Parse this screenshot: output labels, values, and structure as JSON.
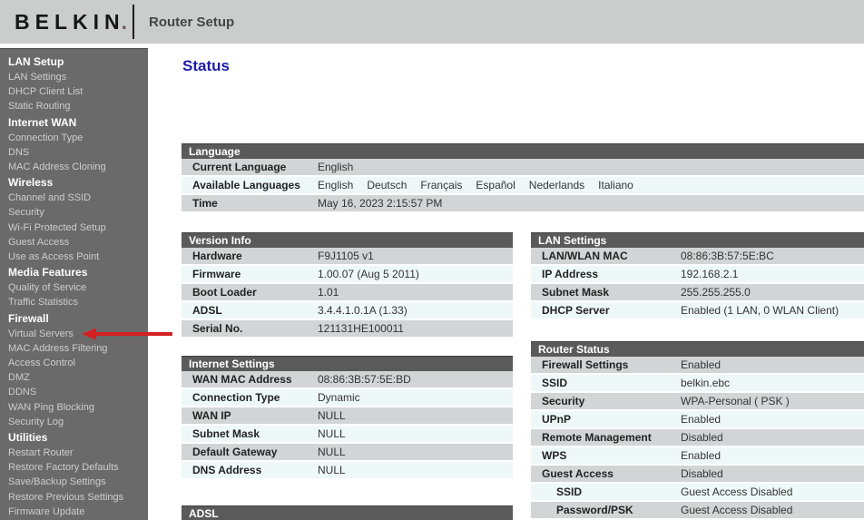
{
  "colors": {
    "accent_red": "#d42020",
    "title_blue": "#1c1cab",
    "header_bg": "#cbcdcd",
    "sidebar_bg": "#6a6a6a",
    "table_header_bg": "#5a5a5a",
    "row_gray": "#d2d5d5",
    "row_light": "#eff8f8"
  },
  "header": {
    "logo": "BELKIN",
    "logo_dot": ".",
    "title": "Router Setup"
  },
  "sidebar": {
    "items": [
      {
        "label": "LAN Setup",
        "type": "section"
      },
      {
        "label": "LAN Settings",
        "type": "link"
      },
      {
        "label": "DHCP Client List",
        "type": "link"
      },
      {
        "label": "Static Routing",
        "type": "link"
      },
      {
        "label": "Internet WAN",
        "type": "section"
      },
      {
        "label": "Connection Type",
        "type": "link"
      },
      {
        "label": "DNS",
        "type": "link"
      },
      {
        "label": "MAC Address Cloning",
        "type": "link"
      },
      {
        "label": "Wireless",
        "type": "section"
      },
      {
        "label": "Channel and SSID",
        "type": "link"
      },
      {
        "label": "Security",
        "type": "link"
      },
      {
        "label": "Wi-Fi Protected Setup",
        "type": "link"
      },
      {
        "label": "Guest Access",
        "type": "link"
      },
      {
        "label": "Use as Access Point",
        "type": "link"
      },
      {
        "label": "Media Features",
        "type": "section"
      },
      {
        "label": "Quality of Service",
        "type": "link"
      },
      {
        "label": "Traffic Statistics",
        "type": "link"
      },
      {
        "label": "Firewall",
        "type": "section"
      },
      {
        "label": "Virtual Servers",
        "type": "link",
        "highlighted": true
      },
      {
        "label": "MAC Address Filtering",
        "type": "link"
      },
      {
        "label": "Access Control",
        "type": "link"
      },
      {
        "label": "DMZ",
        "type": "link"
      },
      {
        "label": "DDNS",
        "type": "link"
      },
      {
        "label": "WAN Ping Blocking",
        "type": "link"
      },
      {
        "label": "Security Log",
        "type": "link"
      },
      {
        "label": "Utilities",
        "type": "section"
      },
      {
        "label": "Restart Router",
        "type": "link"
      },
      {
        "label": "Restore Factory Defaults",
        "type": "link"
      },
      {
        "label": "Save/Backup Settings",
        "type": "link"
      },
      {
        "label": "Restore Previous Settings",
        "type": "link"
      },
      {
        "label": "Firmware Update",
        "type": "link"
      }
    ]
  },
  "annotation": {
    "arrow_target": "Virtual Servers"
  },
  "main": {
    "title": "Status",
    "tables": {
      "language": {
        "title": "Language",
        "rows": [
          {
            "label": "Current Language",
            "value": "English"
          },
          {
            "label": "Available Languages",
            "languages": [
              "English",
              "Deutsch",
              "Français",
              "Español",
              "Nederlands",
              "Italiano"
            ]
          },
          {
            "label": "Time",
            "value": "May 16, 2023  2:15:57 PM"
          }
        ]
      },
      "version_info": {
        "title": "Version Info",
        "rows": [
          {
            "label": "Hardware",
            "value": "F9J1105 v1"
          },
          {
            "label": "Firmware",
            "value": "1.00.07 (Aug 5 2011)"
          },
          {
            "label": "Boot Loader",
            "value": "1.01"
          },
          {
            "label": "ADSL",
            "value": "3.4.4.1.0.1A (1.33)"
          },
          {
            "label": "Serial No.",
            "value": "121131HE100011"
          }
        ]
      },
      "internet_settings": {
        "title": "Internet Settings",
        "rows": [
          {
            "label": "WAN MAC Address",
            "value": "08:86:3B:57:5E:BD"
          },
          {
            "label": "Connection Type",
            "value": "Dynamic"
          },
          {
            "label": "WAN IP",
            "value": "NULL"
          },
          {
            "label": "Subnet Mask",
            "value": "NULL"
          },
          {
            "label": "Default Gateway",
            "value": "NULL"
          },
          {
            "label": "DNS Address",
            "value": "NULL"
          }
        ]
      },
      "adsl": {
        "title": "ADSL",
        "rows": []
      },
      "lan_settings": {
        "title": "LAN Settings",
        "rows": [
          {
            "label": "LAN/WLAN MAC",
            "value": "08:86:3B:57:5E:BC"
          },
          {
            "label": "IP Address",
            "value": "192.168.2.1"
          },
          {
            "label": "Subnet Mask",
            "value": "255.255.255.0"
          },
          {
            "label": "DHCP Server",
            "value": "Enabled (1 LAN, 0 WLAN Client)"
          }
        ]
      },
      "router_status": {
        "title": "Router Status",
        "rows": [
          {
            "label": "Firewall Settings",
            "value": "Enabled"
          },
          {
            "label": "SSID",
            "value": "belkin.ebc"
          },
          {
            "label": "Security",
            "value": "WPA-Personal ( PSK )"
          },
          {
            "label": "UPnP",
            "value": "Enabled"
          },
          {
            "label": "Remote Management",
            "value": "Disabled"
          },
          {
            "label": "WPS",
            "value": "Enabled"
          },
          {
            "label": "Guest Access",
            "value": "Disabled"
          },
          {
            "label": "SSID",
            "value": "Guest Access Disabled",
            "indent": true
          },
          {
            "label": "Password/PSK",
            "value": "Guest Access Disabled",
            "indent": true
          }
        ]
      }
    }
  }
}
